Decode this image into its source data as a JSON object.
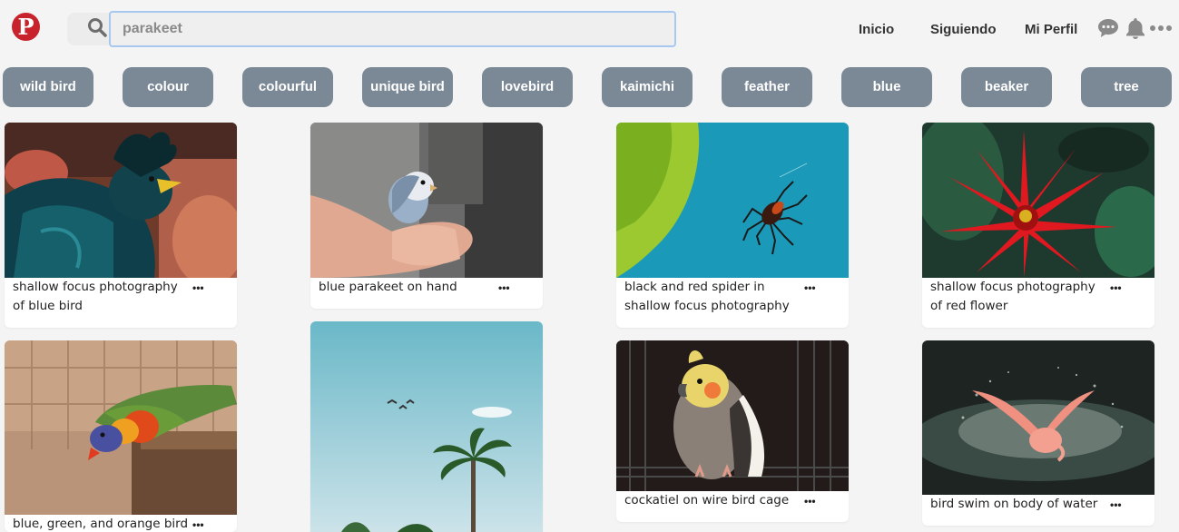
{
  "header": {
    "logo_letter": "P",
    "search": {
      "value": "parakeet",
      "placeholder": ""
    },
    "nav": {
      "home": "Inicio",
      "following": "Siguiendo",
      "profile": "Mi Perfil"
    },
    "icons": [
      "chat-icon",
      "bell-icon",
      "more-icon"
    ]
  },
  "chips": [
    "wild bird",
    "colour",
    "colourful",
    "unique bird",
    "lovebird",
    "kaimichi",
    "feather",
    "blue",
    "beaker",
    "tree"
  ],
  "pins": [
    {
      "caption": "shallow focus photography of blue bird",
      "more": "•••"
    },
    {
      "caption": "blue, green, and orange bird",
      "more": "•••"
    },
    {
      "caption": "blue parakeet on hand",
      "more": "•••"
    },
    {
      "caption": "",
      "more": ""
    },
    {
      "caption": "black and red spider in shallow focus photography",
      "more": "•••"
    },
    {
      "caption": "cockatiel on wire bird cage",
      "more": "•••"
    },
    {
      "caption": "shallow focus photography of red flower",
      "more": "•••"
    },
    {
      "caption": "bird swim on body of water",
      "more": "•••"
    }
  ],
  "colors": {
    "brand": "#c8232c",
    "chip": "#7b8896",
    "search_border": "#a8c8f0"
  }
}
